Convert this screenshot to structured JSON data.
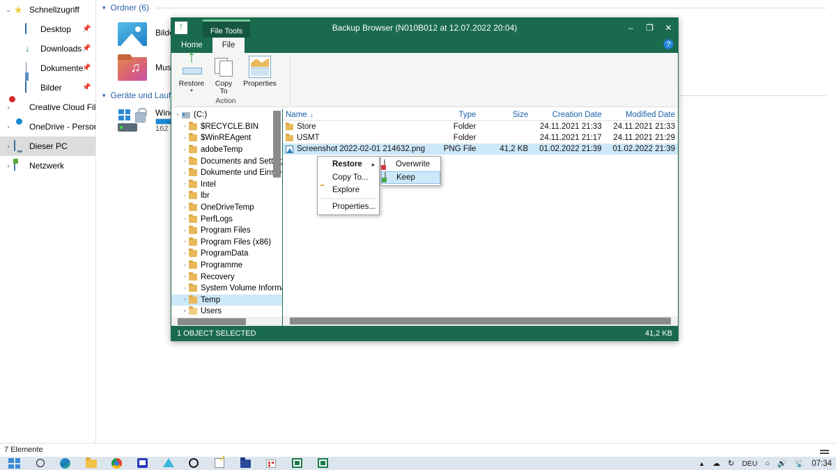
{
  "explorer": {
    "nav_items": [
      {
        "label": "Schnellzugriff",
        "icon": "star-icon",
        "chevron": "down",
        "indent": false,
        "pinned": false,
        "selected": false
      },
      {
        "label": "Desktop",
        "icon": "desktop-icon",
        "chevron": "",
        "indent": true,
        "pinned": true,
        "selected": false
      },
      {
        "label": "Downloads",
        "icon": "download-icon",
        "chevron": "",
        "indent": true,
        "pinned": true,
        "selected": false
      },
      {
        "label": "Dokumente",
        "icon": "document-icon",
        "chevron": "",
        "indent": true,
        "pinned": true,
        "selected": false
      },
      {
        "label": "Bilder",
        "icon": "pictures-icon",
        "chevron": "",
        "indent": true,
        "pinned": true,
        "selected": false
      },
      {
        "label": "Creative Cloud Files",
        "icon": "creative-cloud-icon",
        "chevron": "right",
        "indent": false,
        "pinned": false,
        "selected": false
      },
      {
        "label": "OneDrive - Personal",
        "icon": "cloud-icon",
        "chevron": "right",
        "indent": false,
        "pinned": false,
        "selected": false
      },
      {
        "label": "Dieser PC",
        "icon": "this-pc-icon",
        "chevron": "right",
        "indent": false,
        "pinned": false,
        "selected": true
      },
      {
        "label": "Netzwerk",
        "icon": "network-icon",
        "chevron": "right",
        "indent": false,
        "pinned": false,
        "selected": false
      }
    ],
    "groups": [
      {
        "title": "Ordner (6)"
      },
      {
        "title": "Geräte und Laufwerke"
      }
    ],
    "folders": [
      {
        "name": "Bilde",
        "icon": "pictures-folder-icon"
      },
      {
        "name": "Musi",
        "icon": "music-folder-icon"
      }
    ],
    "drives": [
      {
        "name": "Wind",
        "free": "162 G",
        "icon": "windows-drive-icon"
      }
    ],
    "status": "7 Elemente"
  },
  "backup_browser": {
    "title": "Backup Browser (N010B012 at 12.07.2022 20:04)",
    "contextual_tab": "File Tools",
    "tabs": [
      {
        "label": "Home",
        "active": false
      },
      {
        "label": "File",
        "active": true
      }
    ],
    "window_buttons": {
      "minimize": "–",
      "maximize": "❐",
      "close": "✕",
      "help": "?"
    },
    "ribbon": {
      "group_label": "Action",
      "buttons": [
        {
          "label": "Restore",
          "icon": "restore-icon",
          "has_caret": true
        },
        {
          "label": "Copy\nTo",
          "label_line1": "Copy",
          "label_line2": "To",
          "icon": "copy-to-icon",
          "has_caret": false
        },
        {
          "label": "Properties",
          "icon": "properties-icon",
          "has_caret": false
        }
      ]
    },
    "tree": [
      {
        "label": "(C:)",
        "level": 0,
        "expander": "•",
        "icon": "drive",
        "selected": false
      },
      {
        "label": "$RECYCLE.BIN",
        "level": 1,
        "expander": "›",
        "icon": "folder",
        "selected": false
      },
      {
        "label": "$WinREAgent",
        "level": 1,
        "expander": "›",
        "icon": "folder",
        "selected": false
      },
      {
        "label": "adobeTemp",
        "level": 1,
        "expander": "›",
        "icon": "folder",
        "selected": false
      },
      {
        "label": "Documents and Settings",
        "level": 1,
        "expander": "›",
        "icon": "folder",
        "selected": false
      },
      {
        "label": "Dokumente und Einstell",
        "level": 1,
        "expander": "›",
        "icon": "folder",
        "selected": false
      },
      {
        "label": "Intel",
        "level": 1,
        "expander": "›",
        "icon": "folder",
        "selected": false
      },
      {
        "label": "lbr",
        "level": 1,
        "expander": "›",
        "icon": "folder",
        "selected": false
      },
      {
        "label": "OneDriveTemp",
        "level": 1,
        "expander": "›",
        "icon": "folder",
        "selected": false
      },
      {
        "label": "PerfLogs",
        "level": 1,
        "expander": "›",
        "icon": "folder",
        "selected": false
      },
      {
        "label": "Program Files",
        "level": 1,
        "expander": "›",
        "icon": "folder",
        "selected": false
      },
      {
        "label": "Program Files (x86)",
        "level": 1,
        "expander": "›",
        "icon": "folder",
        "selected": false
      },
      {
        "label": "ProgramData",
        "level": 1,
        "expander": "›",
        "icon": "folder",
        "selected": false
      },
      {
        "label": "Programme",
        "level": 1,
        "expander": "›",
        "icon": "folder",
        "selected": false
      },
      {
        "label": "Recovery",
        "level": 1,
        "expander": "›",
        "icon": "folder",
        "selected": false
      },
      {
        "label": "System Volume Informa",
        "level": 1,
        "expander": "›",
        "icon": "folder",
        "selected": false
      },
      {
        "label": "Temp",
        "level": 1,
        "expander": "›",
        "icon": "folder",
        "selected": true
      },
      {
        "label": "Users",
        "level": 1,
        "expander": "•",
        "icon": "folder-open",
        "selected": false
      }
    ],
    "columns": [
      {
        "label": "Name",
        "sorted": true,
        "sort_arrow": "↓"
      },
      {
        "label": "Type",
        "sorted": false
      },
      {
        "label": "Size",
        "sorted": false
      },
      {
        "label": "Creation Date",
        "sorted": false
      },
      {
        "label": "Modified Date",
        "sorted": false
      }
    ],
    "rows": [
      {
        "name": "Store",
        "icon": "folder-icon",
        "type": "Folder",
        "size": "",
        "creation": "24.11.2021 21:33",
        "modified": "24.11.2021 21:33",
        "selected": false
      },
      {
        "name": "USMT",
        "icon": "folder-icon",
        "type": "Folder",
        "size": "",
        "creation": "24.11.2021 21:17",
        "modified": "24.11.2021 21:29",
        "selected": false
      },
      {
        "name": "Screenshot 2022-02-01 214632.png",
        "icon": "png-file-icon",
        "type": "PNG  File",
        "size": "41,2 KB",
        "creation": "01.02.2022 21:39",
        "modified": "01.02.2022 21:39",
        "selected": true
      }
    ],
    "status": {
      "left": "1 OBJECT SELECTED",
      "right": "41,2 KB"
    }
  },
  "context_menu": {
    "items": [
      {
        "label": "Restore",
        "bold": true,
        "has_submenu": true,
        "submenu_arrow": "▸",
        "icon": ""
      },
      {
        "label": "Copy To...",
        "bold": false,
        "has_submenu": false,
        "icon": ""
      },
      {
        "label": "Explore",
        "bold": false,
        "has_submenu": false,
        "icon": "explore-icon"
      },
      {
        "label": "Properties...",
        "bold": false,
        "has_submenu": false,
        "icon": "",
        "separator_before": true
      }
    ],
    "submenu": {
      "items": [
        {
          "label": "Overwrite",
          "icon": "overwrite-icon",
          "highlighted": false
        },
        {
          "label": "Keep",
          "icon": "keep-icon",
          "highlighted": true
        }
      ]
    }
  },
  "taskbar": {
    "icons": [
      "start-icon",
      "search-icon",
      "edge-icon",
      "file-explorer-icon",
      "chrome-icon",
      "bitwarden-icon",
      "teal-app-icon",
      "opera-icon",
      "notes-icon",
      "navy-folder-icon",
      "red-dots-icon",
      "green-app-icon",
      "green-app-active-icon"
    ],
    "language": "DEU",
    "clock": "07:34",
    "tray_icons": [
      "up-arrow-icon",
      "onedrive-icon",
      "refresh-icon",
      "chevron-icon",
      "volume-icon",
      "network-icon"
    ]
  }
}
